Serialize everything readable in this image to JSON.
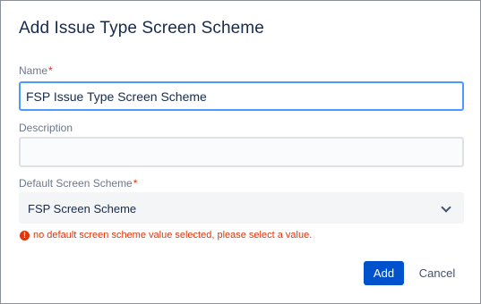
{
  "dialog": {
    "title": "Add Issue Type Screen Scheme"
  },
  "form": {
    "name": {
      "label": "Name",
      "required_marker": "*",
      "value": "FSP Issue Type Screen Scheme"
    },
    "description": {
      "label": "Description",
      "value": ""
    },
    "default_screen_scheme": {
      "label": "Default Screen Scheme",
      "required_marker": "*",
      "selected": "FSP Screen Scheme",
      "error": "no default screen scheme value selected, please select a value."
    }
  },
  "buttons": {
    "add": "Add",
    "cancel": "Cancel"
  },
  "colors": {
    "primary": "#0052cc",
    "error": "#de350b",
    "focus_border": "#4c9aff"
  },
  "icons": {
    "error": "error-icon",
    "dropdown": "chevron-down-icon"
  }
}
